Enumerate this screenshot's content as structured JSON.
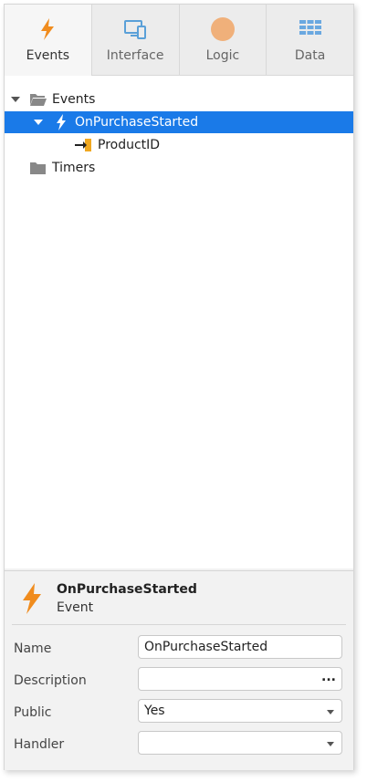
{
  "tabs": [
    {
      "label": "Events",
      "icon": "lightning-icon",
      "active": true
    },
    {
      "label": "Interface",
      "icon": "devices-icon",
      "active": false
    },
    {
      "label": "Logic",
      "icon": "circle-icon",
      "active": false
    },
    {
      "label": "Data",
      "icon": "grid-icon",
      "active": false
    }
  ],
  "tree": {
    "events_folder": "Events",
    "event_item": "OnPurchaseStarted",
    "param_item": "ProductID",
    "timers_folder": "Timers"
  },
  "properties": {
    "title": "OnPurchaseStarted",
    "subtitle": "Event",
    "name_label": "Name",
    "name_value": "OnPurchaseStarted",
    "description_label": "Description",
    "description_value": "",
    "description_button": "...",
    "public_label": "Public",
    "public_value": "Yes",
    "handler_label": "Handler",
    "handler_value": ""
  },
  "colors": {
    "accent": "#1a7ae8",
    "event_orange": "#f08c1e",
    "interface_blue": "#5aa0d8",
    "logic_peach": "#f0b07a",
    "data_blue": "#6aa8e0"
  }
}
